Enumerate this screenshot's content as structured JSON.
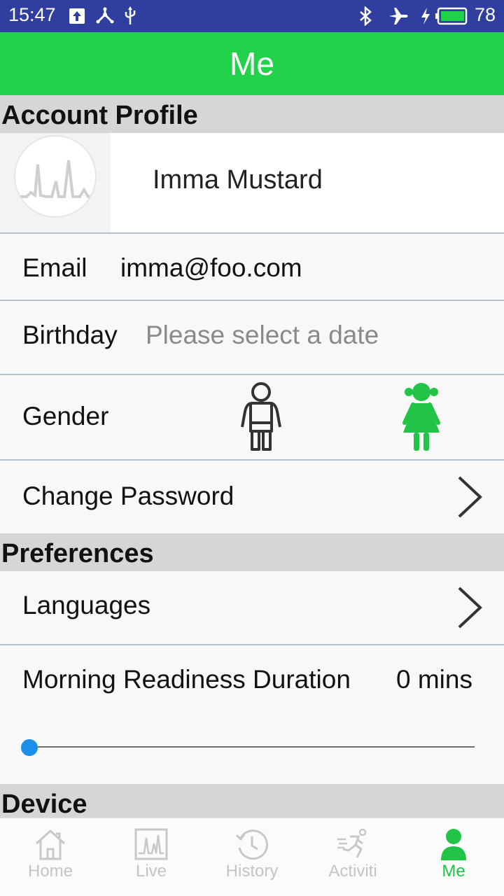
{
  "status_bar": {
    "time": "15:47",
    "battery": "78",
    "icons": [
      "upload-icon",
      "usb-share-icon",
      "usb-icon",
      "bluetooth-icon",
      "airplane-icon",
      "charging-icon",
      "battery-icon"
    ]
  },
  "header": {
    "title": "Me"
  },
  "account_profile": {
    "section_title": "Account Profile",
    "name": "Imma Mustard",
    "email_label": "Email",
    "email_value": "imma@foo.com",
    "birthday_label": "Birthday",
    "birthday_placeholder": "Please select a date",
    "gender_label": "Gender",
    "gender_options": [
      "male-icon",
      "female-icon"
    ],
    "gender_selected": "female",
    "change_password_label": "Change Password"
  },
  "preferences": {
    "section_title": "Preferences",
    "languages_label": "Languages",
    "morning_readiness_label": "Morning Readiness Duration",
    "morning_readiness_value": "0 mins",
    "morning_readiness_slider_fraction": 0
  },
  "device": {
    "section_title": "Device"
  },
  "tabs": [
    {
      "label": "Home",
      "icon": "home-icon",
      "active": false
    },
    {
      "label": "Live",
      "icon": "live-chart-icon",
      "active": false
    },
    {
      "label": "History",
      "icon": "history-icon",
      "active": false
    },
    {
      "label": "Activiti",
      "icon": "running-icon",
      "active": false
    },
    {
      "label": "Me",
      "icon": "person-icon",
      "active": true
    }
  ],
  "colors": {
    "header": "#22d24b",
    "status_bar": "#303f9f",
    "accent": "#22c447",
    "slider": "#1a8fea"
  }
}
